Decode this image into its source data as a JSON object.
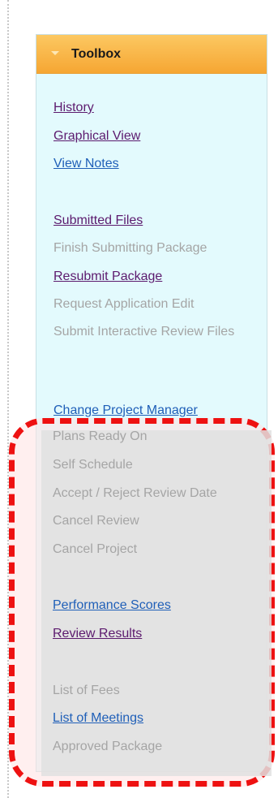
{
  "toolbox": {
    "title": "Toolbox",
    "colors": {
      "header": "#f8b44a",
      "panel": "#e3fafd",
      "link": "#1f5fb8",
      "visited_link": "#5c1a6e",
      "disabled": "#a5a5a5",
      "highlight_border": "#ee1111"
    },
    "groups": [
      {
        "items": [
          {
            "label": "History",
            "state": "visited-link"
          },
          {
            "label": "Graphical View",
            "state": "visited-link"
          },
          {
            "label": "View Notes",
            "state": "link"
          }
        ]
      },
      {
        "items": [
          {
            "label": "Submitted Files",
            "state": "visited-link"
          },
          {
            "label": "Finish Submitting Package",
            "state": "disabled"
          },
          {
            "label": "Resubmit Package",
            "state": "visited-link"
          },
          {
            "label": "Request Application Edit",
            "state": "disabled"
          },
          {
            "label": "Submit Interactive Review Files",
            "state": "disabled"
          }
        ]
      },
      {
        "items": [
          {
            "label": "Change Project Manager",
            "state": "link"
          },
          {
            "label": "Plans Ready On",
            "state": "disabled"
          },
          {
            "label": "Self Schedule",
            "state": "disabled"
          },
          {
            "label": "Accept / Reject Review Date",
            "state": "disabled"
          },
          {
            "label": "Cancel Review",
            "state": "disabled"
          },
          {
            "label": "Cancel Project",
            "state": "disabled"
          }
        ]
      },
      {
        "items": [
          {
            "label": "Performance Scores",
            "state": "link"
          },
          {
            "label": "Review Results",
            "state": "visited-link"
          }
        ]
      },
      {
        "items": [
          {
            "label": "List of Fees",
            "state": "disabled"
          },
          {
            "label": "List of Meetings",
            "state": "link"
          },
          {
            "label": "Approved Package",
            "state": "disabled"
          }
        ]
      }
    ]
  }
}
